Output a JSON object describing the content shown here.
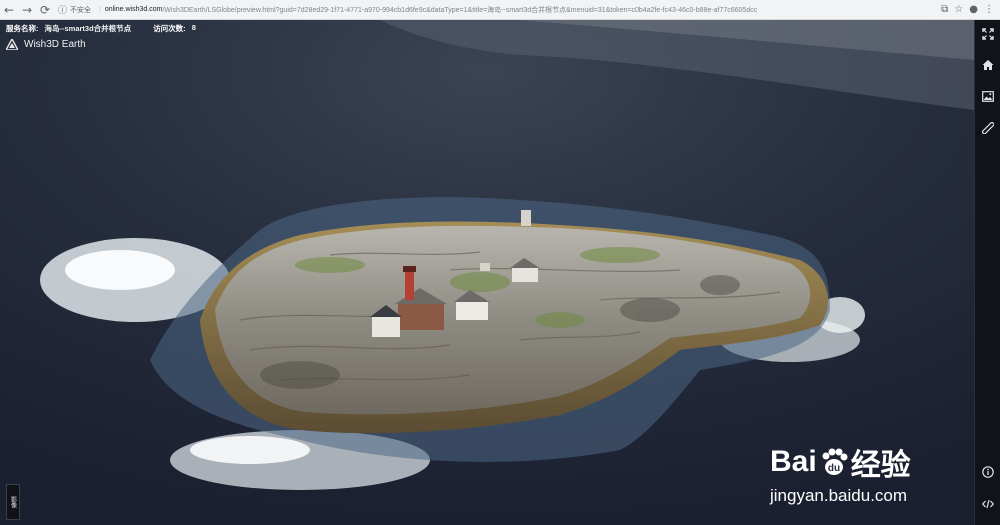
{
  "browser": {
    "security_label": "不安全",
    "host": "online.wish3d.com",
    "path": "/Wish3DEarth/LSGlobe/preview.html?guid=7d28ed29-1f71-4771-a970-994cb1d6fe9c&dataType=1&title=海岛--smart3d合并根节点&menuid=31&token=c0b4a2fe-fc43-46c0-b88e-af77c6605dcc"
  },
  "info": {
    "service_label": "服务名称:",
    "service_name": "海岛--smart3d合并根节点",
    "visits_label": "访问次数:",
    "visits": "8"
  },
  "app": {
    "title": "Wish3D Earth"
  },
  "side_tab": {
    "label": "影像"
  },
  "watermark": {
    "brand": "Bai",
    "brand_cn": "经验",
    "url": "jingyan.baidu.com"
  },
  "toolbar": {
    "icons": [
      "fullscreen-icon",
      "home-icon",
      "image-icon",
      "ruler-icon",
      "info-icon",
      "code-icon"
    ]
  },
  "colors": {
    "sea": "#1f2535",
    "toolbar": "#111318",
    "rock": "#8d8a84"
  }
}
